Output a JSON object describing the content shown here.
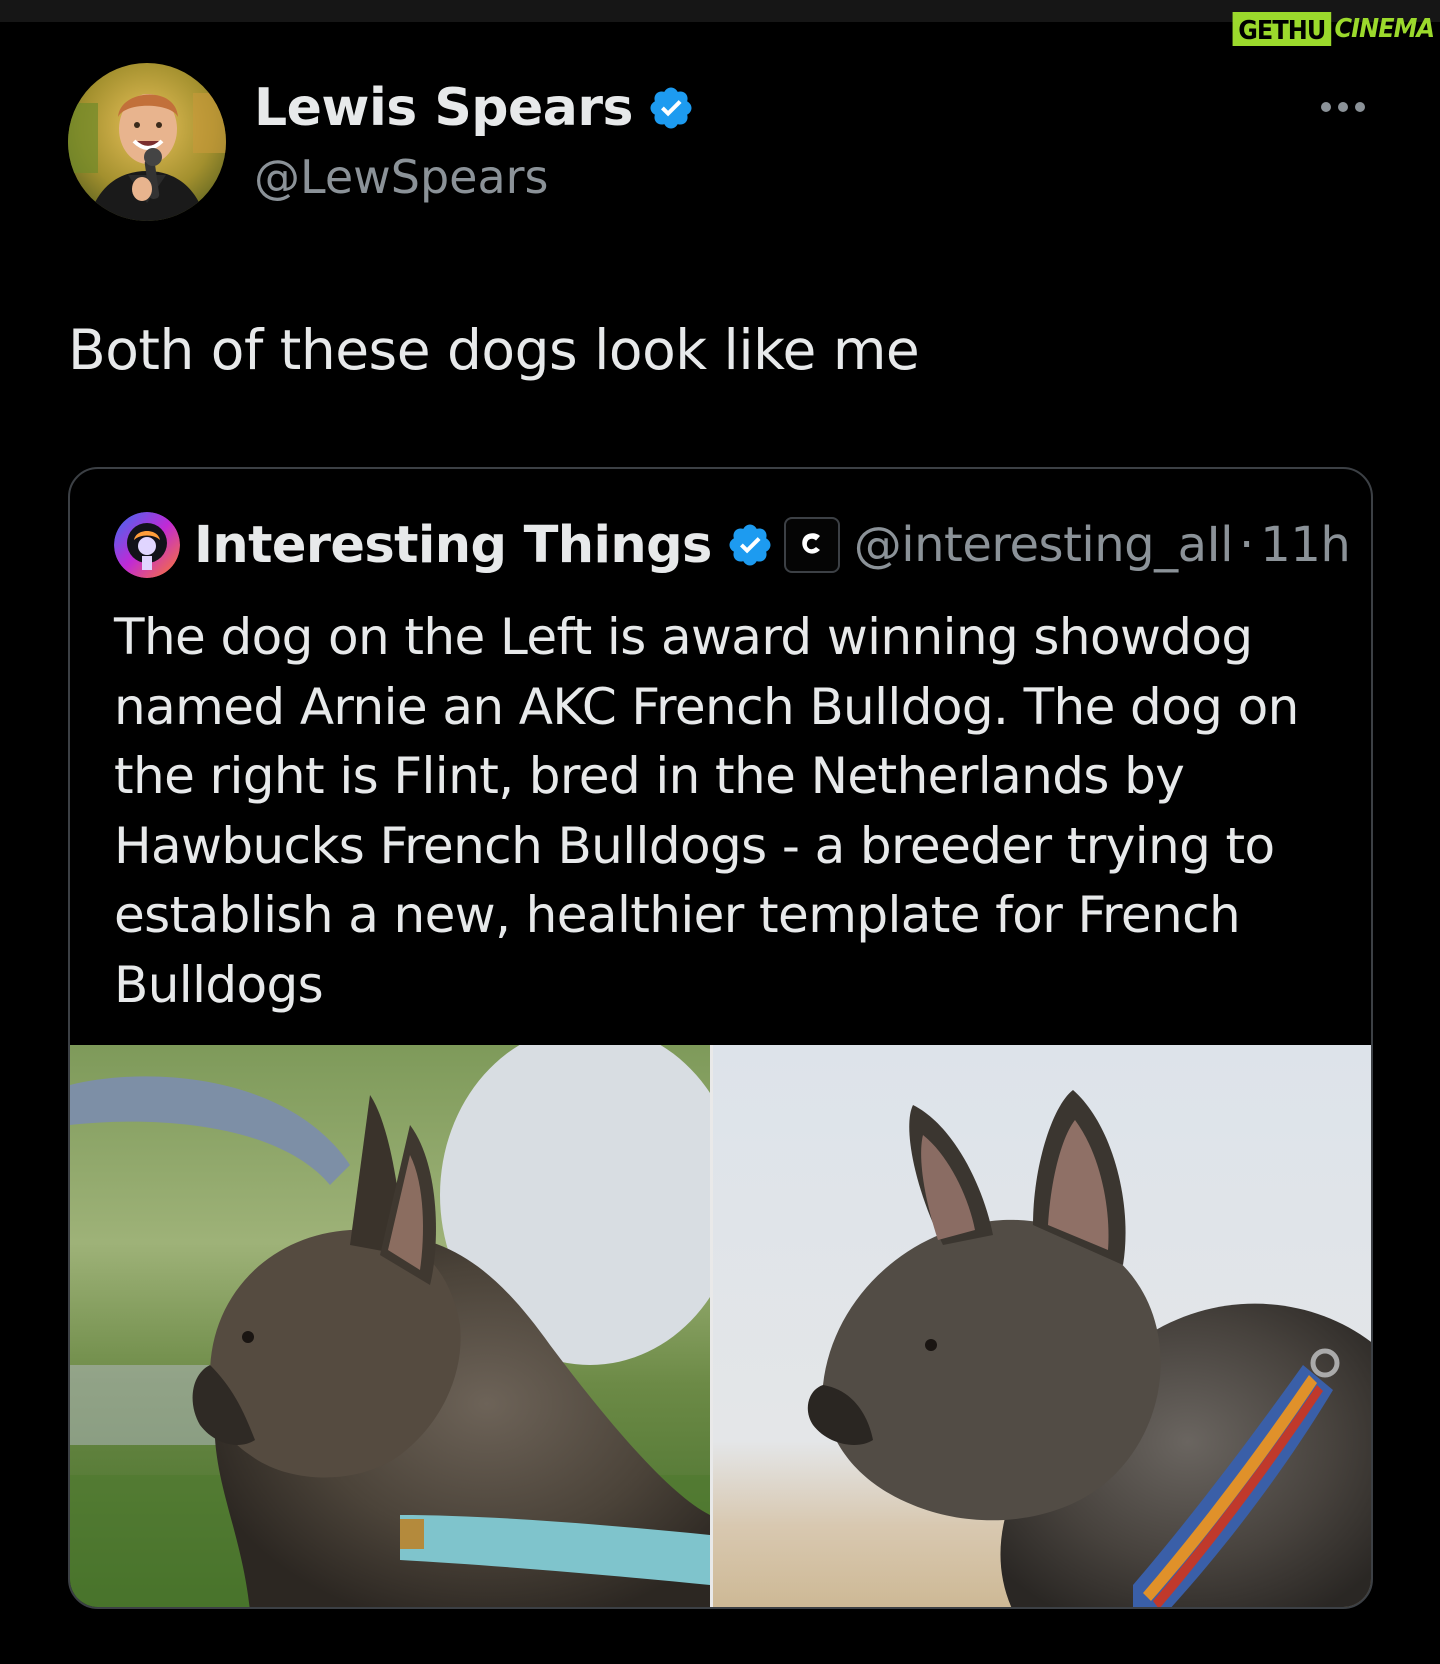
{
  "watermark": {
    "part1": "GETHU",
    "part2": "CINEMA"
  },
  "tweet": {
    "author_name": "Lewis Spears",
    "author_handle": "@LewSpears",
    "text": "Both of these dogs look like me"
  },
  "quote": {
    "author_name": "Interesting Things",
    "author_handle": "@interesting_aIl",
    "separator": "·",
    "time": "11h",
    "badge_letter": "C",
    "text_lines": [
      "The dog on the Left is award winning showdog",
      "named Arnie an AKC French Bulldog. The dog on",
      "the right is Flint, bred in the Netherlands by",
      "Hawbucks French Bulldogs - a breeder trying to",
      "establish a new, healthier template for French",
      "Bulldogs"
    ]
  },
  "icons": {
    "verified": "verified-badge-icon",
    "more": "more-options-icon",
    "affiliate": "affiliate-badge-icon"
  },
  "colors": {
    "background": "#000000",
    "text": "#e7e9ea",
    "secondary_text": "#8b9298",
    "verified_blue": "#1d9bf0",
    "card_border": "#3c4045",
    "watermark_green": "#9bd92c"
  }
}
